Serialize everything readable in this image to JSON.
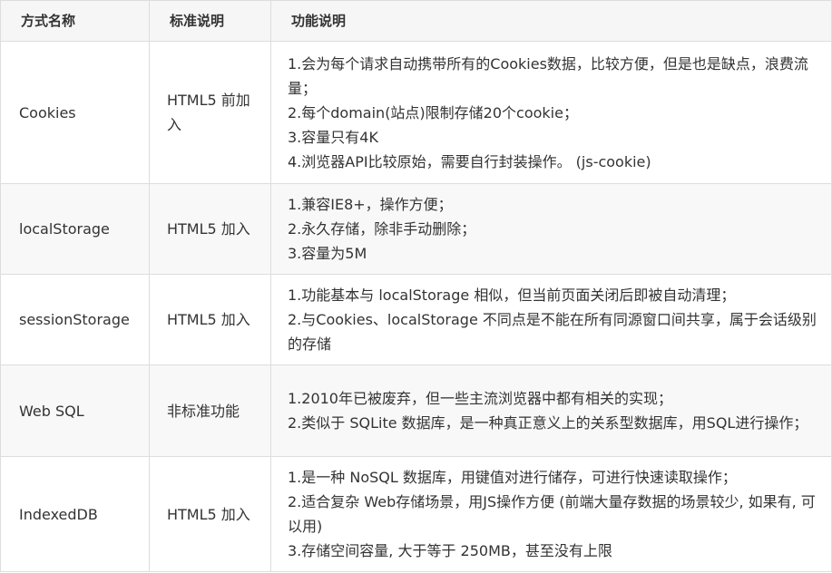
{
  "table": {
    "headers": [
      "方式名称",
      "标准说明",
      "功能说明"
    ],
    "rows": [
      {
        "name": "Cookies",
        "standard": "HTML5 前加入",
        "features": [
          "1.会为每个请求自动携带所有的Cookies数据，比较方便，但是也是缺点，浪费流量；",
          "2.每个domain(站点)限制存储20个cookie；",
          "3.容量只有4K",
          "4.浏览器API比较原始，需要自行封装操作。 (js-cookie)"
        ]
      },
      {
        "name": "localStorage",
        "standard": "HTML5 加入",
        "features": [
          "1.兼容IE8+，操作方便；",
          "2.永久存储，除非手动删除；",
          "3.容量为5M"
        ]
      },
      {
        "name": "sessionStorage",
        "standard": "HTML5 加入",
        "features": [
          "1.功能基本与 localStorage 相似，但当前页面关闭后即被自动清理；",
          "2.与Cookies、localStorage 不同点是不能在所有同源窗口间共享，属于会话级别的存储"
        ]
      },
      {
        "name": "Web SQL",
        "standard": "非标准功能",
        "features": [
          "1.2010年已被废弃，但一些主流浏览器中都有相关的实现；",
          "2.类似于 SQLite 数据库，是一种真正意义上的关系型数据库，用SQL进行操作；"
        ]
      },
      {
        "name": "IndexedDB",
        "standard": "HTML5 加入",
        "features": [
          "1.是一种 NoSQL 数据库，用键值对进行储存，可进行快速读取操作；",
          "2.适合复杂 Web存储场景，用JS操作方便 (前端大量存数据的场景较少, 如果有, 可以用)",
          "3.存储空间容量, 大于等于 250MB，甚至没有上限"
        ]
      }
    ]
  }
}
